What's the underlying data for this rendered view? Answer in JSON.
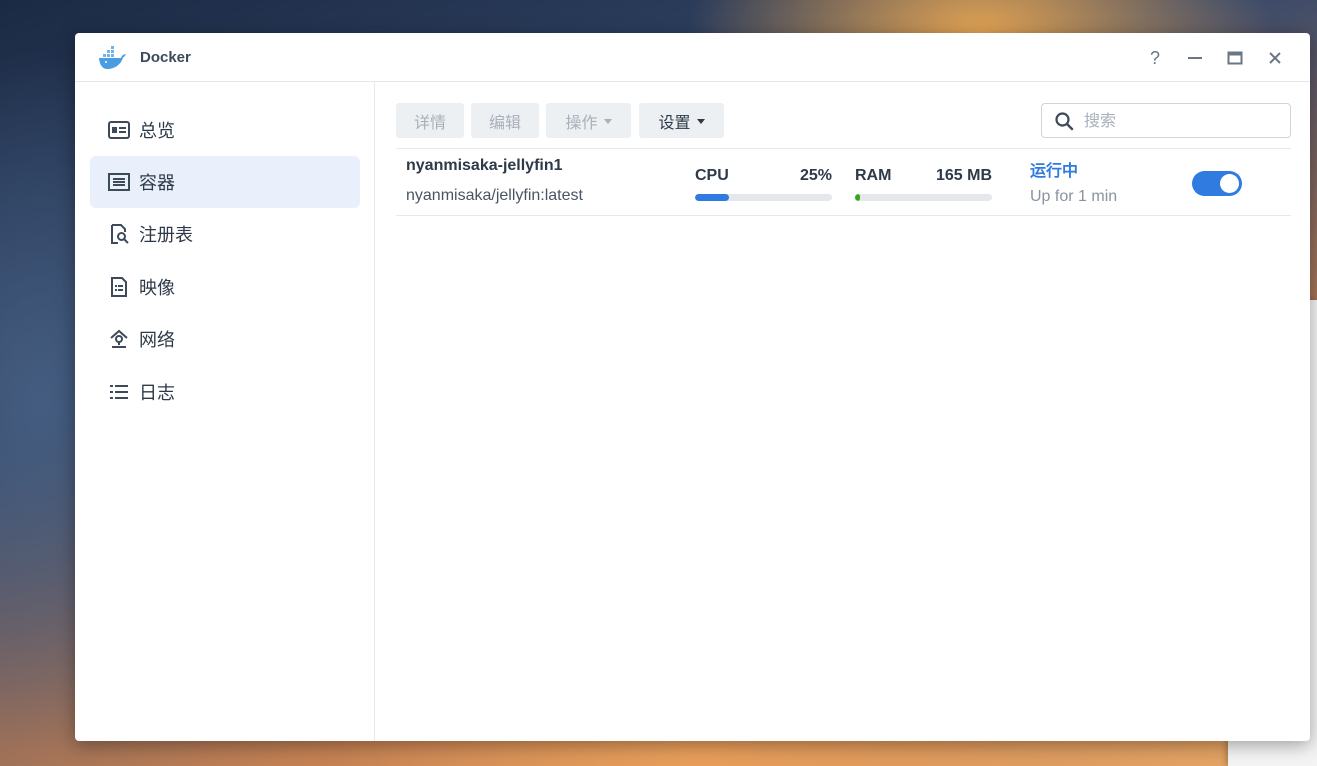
{
  "window": {
    "title": "Docker",
    "controls": {
      "help": "?",
      "minimize": "minimize-icon",
      "maximize": "maximize-icon",
      "close": "close-icon"
    }
  },
  "sidebar": {
    "items": [
      {
        "label": "总览",
        "icon": "overview-icon",
        "active": false
      },
      {
        "label": "容器",
        "icon": "container-icon",
        "active": true
      },
      {
        "label": "注册表",
        "icon": "registry-icon",
        "active": false
      },
      {
        "label": "映像",
        "icon": "image-icon",
        "active": false
      },
      {
        "label": "网络",
        "icon": "network-icon",
        "active": false
      },
      {
        "label": "日志",
        "icon": "log-icon",
        "active": false
      }
    ]
  },
  "toolbar": {
    "details_label": "详情",
    "edit_label": "编辑",
    "action_label": "操作",
    "settings_label": "设置",
    "search_placeholder": "搜索"
  },
  "containers": [
    {
      "name": "nyanmisaka-jellyfin1",
      "image": "nyanmisaka/jellyfin:latest",
      "cpu_label": "CPU",
      "cpu_value": "25%",
      "cpu_fraction": 0.25,
      "ram_label": "RAM",
      "ram_value": "165 MB",
      "ram_fraction": 0.04,
      "status": "运行中",
      "uptime": "Up for 1 min",
      "enabled": true
    }
  ],
  "colors": {
    "accent": "#2f7be0",
    "cpu_bar": "#2f7be0",
    "ram_bar": "#3aa520",
    "active_nav_bg": "#e9f0fb"
  }
}
